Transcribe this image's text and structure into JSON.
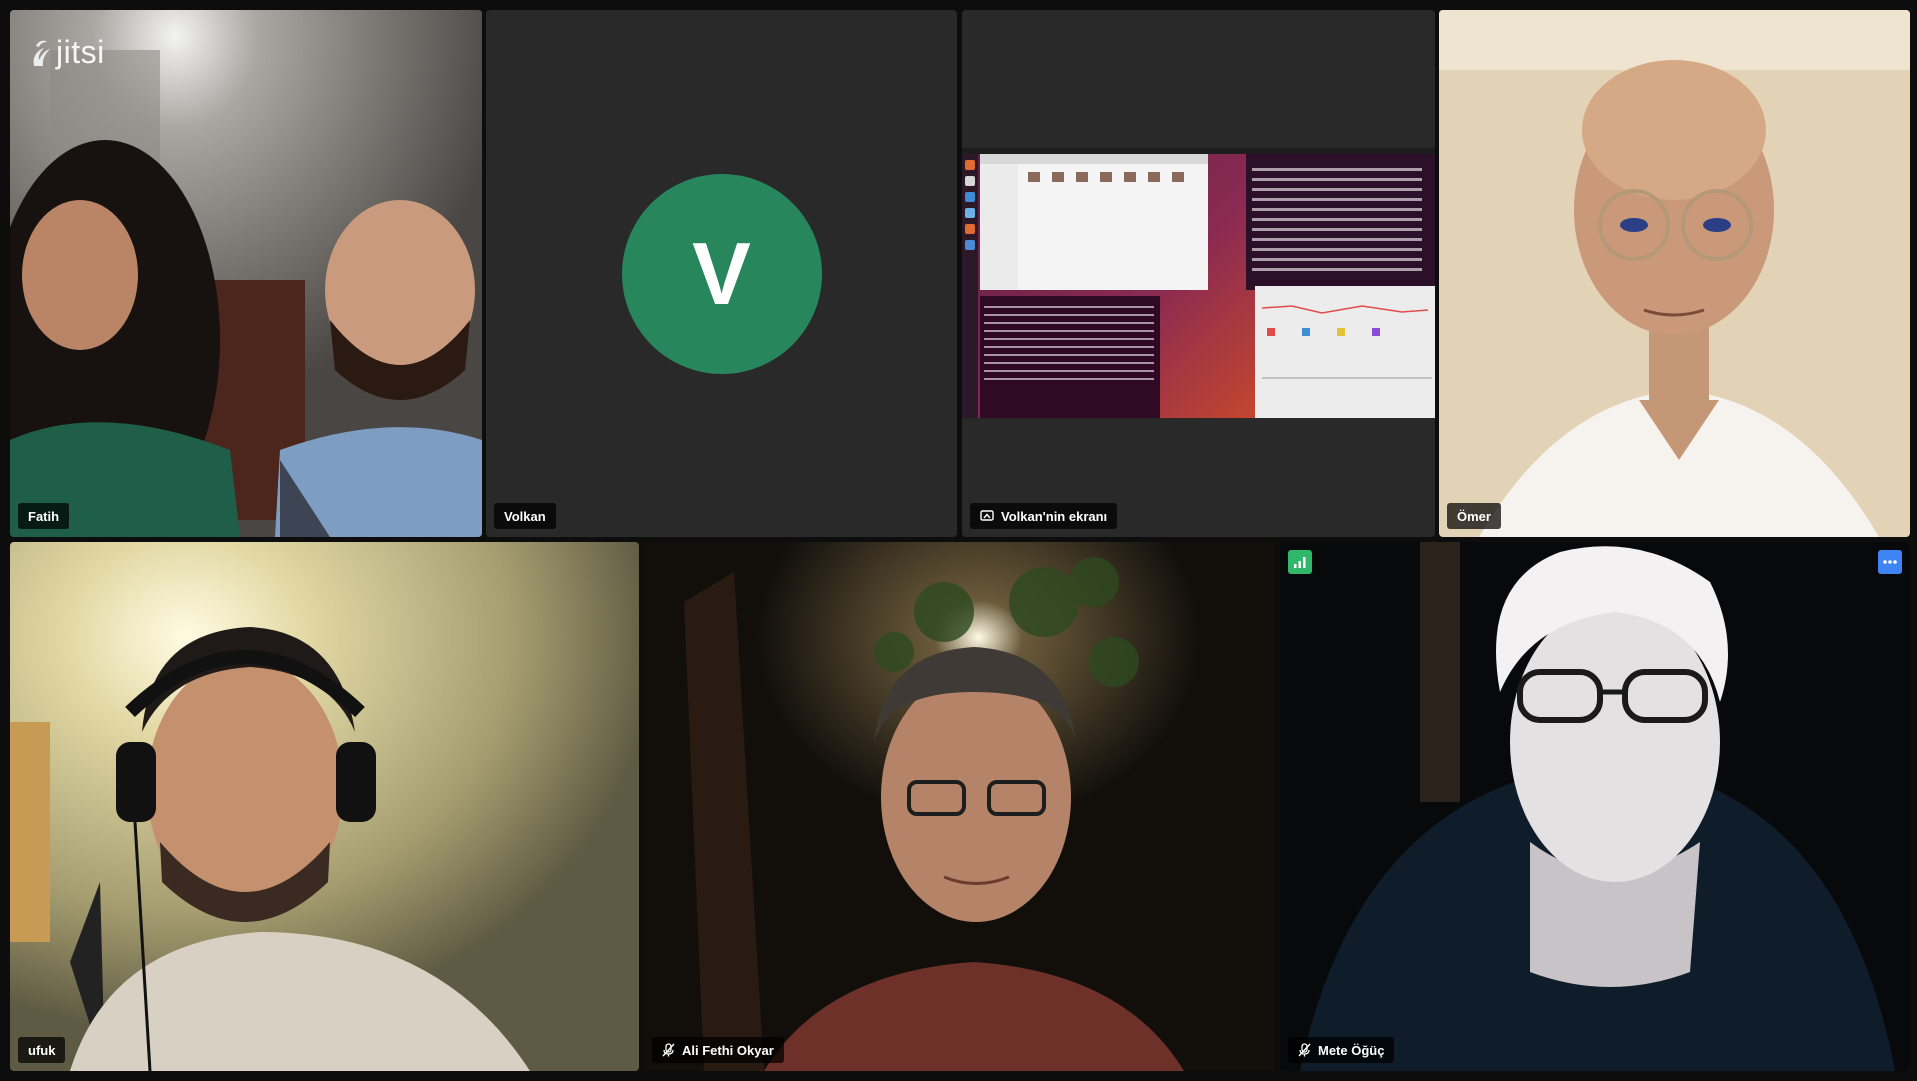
{
  "app": {
    "brand": "jitsi",
    "accent": "#3f84f5"
  },
  "participants": [
    {
      "id": "fatih",
      "name": "Fatih",
      "active": true,
      "muted": false
    },
    {
      "id": "volkan",
      "name": "Volkan",
      "avatar_initial": "V",
      "avatar_color": "#27865c",
      "muted": false
    },
    {
      "id": "volkan-screen",
      "name": "Volkan'nin ekranı",
      "screen_share": true
    },
    {
      "id": "omer",
      "name": "Ömer",
      "muted": false
    },
    {
      "id": "ufuk",
      "name": "ufuk",
      "muted": false
    },
    {
      "id": "ali",
      "name": "Ali Fethi Okyar",
      "muted": true
    },
    {
      "id": "mete",
      "name": "Mete Öğüç",
      "muted": true,
      "connection_indicator": "good",
      "connection_color": "#31b76a",
      "menu_color": "#3f84f5"
    }
  ]
}
